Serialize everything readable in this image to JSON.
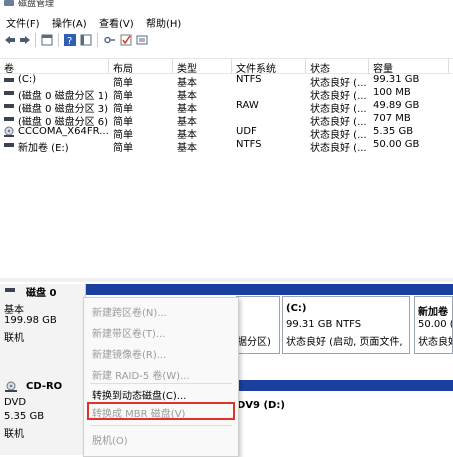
{
  "window": {
    "title": "磁盘管理"
  },
  "menu": {
    "file": "文件(F)",
    "action": "操作(A)",
    "view": "查看(V)",
    "help": "帮助(H)"
  },
  "toolbar": {
    "icons": [
      "back-arrow-icon",
      "forward-arrow-icon",
      "panel-icon",
      "help-icon",
      "panel-icon",
      "key-icon",
      "checkbox-icon",
      "properties-icon"
    ]
  },
  "table": {
    "headers": [
      "卷",
      "布局",
      "类型",
      "文件系统",
      "状态",
      "容量"
    ],
    "rows": [
      {
        "vol": "(C:)",
        "layout": "简单",
        "type": "基本",
        "fs": "NTFS",
        "status": "状态良好 (...",
        "cap": "99.31 GB"
      },
      {
        "vol": "(磁盘 0 磁盘分区 1)",
        "layout": "简单",
        "type": "基本",
        "fs": "",
        "status": "状态良好 (...",
        "cap": "100 MB"
      },
      {
        "vol": "(磁盘 0 磁盘分区 3)",
        "layout": "简单",
        "type": "基本",
        "fs": "RAW",
        "status": "状态良好 (...",
        "cap": "49.89 GB"
      },
      {
        "vol": "(磁盘 0 磁盘分区 6)",
        "layout": "简单",
        "type": "基本",
        "fs": "",
        "status": "状态良好 (...",
        "cap": "707 MB"
      },
      {
        "vol": "CCCOMA_X64FR...",
        "layout": "简单",
        "type": "基本",
        "fs": "UDF",
        "status": "状态良好 (...",
        "cap": "5.35 GB"
      },
      {
        "vol": "新加卷 (E:)",
        "layout": "简单",
        "type": "基本",
        "fs": "NTFS",
        "status": "状态良好 (...",
        "cap": "50.00 GB"
      }
    ]
  },
  "disk0": {
    "name": "磁盘 0",
    "kind": "基本",
    "size": "199.98 GB",
    "state": "联机",
    "partition_fragment": "据分区)",
    "c_title": "(C:)",
    "c_size": "99.31 GB NTFS",
    "c_status": "状态良好 (启动, 页面文件,",
    "e_title": "新加卷",
    "e_size": "50.00 (",
    "e_status": "状态良好"
  },
  "cdrom": {
    "name": "CD-RO",
    "kind": "DVD",
    "size": "5.35 GB",
    "state": "联机",
    "label": "DV9  (D:)"
  },
  "context_menu": {
    "items": [
      {
        "label": "新建跨区卷(N)...",
        "enabled": false
      },
      {
        "label": "新建带区卷(T)...",
        "enabled": false
      },
      {
        "label": "新建镜像卷(R)...",
        "enabled": false
      },
      {
        "label": "新建 RAID-5 卷(W)...",
        "enabled": false
      },
      {
        "label": "转换到动态磁盘(C)...",
        "enabled": true
      },
      {
        "label": "转换成 MBR 磁盘(V)",
        "enabled": false
      },
      {
        "label": "脱机(O)",
        "enabled": false
      }
    ]
  },
  "colors": {
    "bar": "#1b3f9e",
    "highlight": "#e0312a"
  }
}
